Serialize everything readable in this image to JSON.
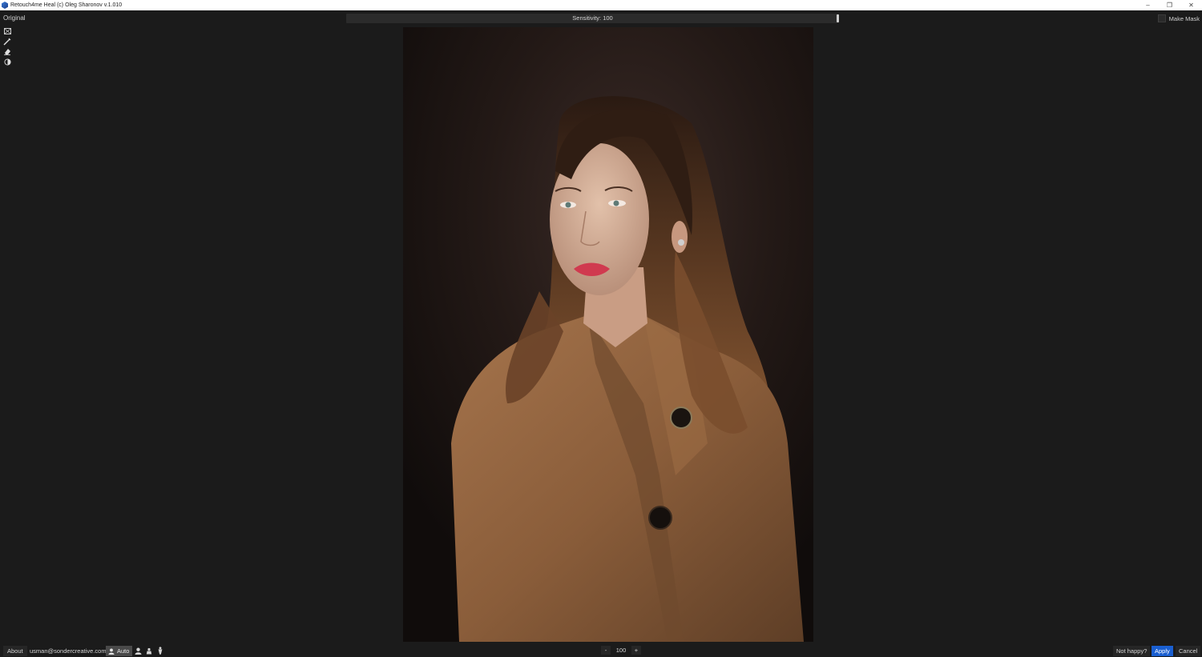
{
  "window": {
    "title": "Retouch4me Heal (c) Oleg Sharonov v.1.010",
    "controls": {
      "minimize": "–",
      "restore": "❐",
      "close": "✕"
    }
  },
  "topbar": {
    "original_label": "Original",
    "sensitivity_label": "Sensitivity: 100",
    "sensitivity_value": 100,
    "make_mask_label": "Make Mask",
    "make_mask_checked": false
  },
  "tools": [
    {
      "icon": "compare-icon"
    },
    {
      "icon": "brush-icon"
    },
    {
      "icon": "eraser-icon"
    },
    {
      "icon": "contrast-icon"
    }
  ],
  "bottombar": {
    "about_label": "About",
    "email": "usman@sondercreative.com",
    "auto_label": "Auto",
    "zoom_minus": "-",
    "zoom_value": "100",
    "zoom_plus": "+",
    "not_happy_label": "Not happy?",
    "apply_label": "Apply",
    "cancel_label": "Cancel"
  },
  "colors": {
    "background": "#1b1b1b",
    "apply_accent": "#1a5fd1"
  }
}
